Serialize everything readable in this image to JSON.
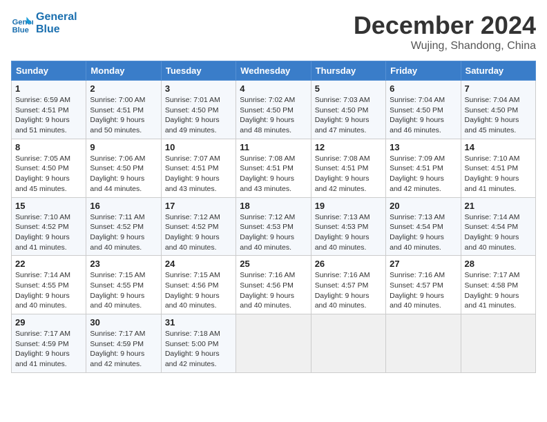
{
  "logo": {
    "line1": "General",
    "line2": "Blue"
  },
  "title": "December 2024",
  "location": "Wujing, Shandong, China",
  "days_of_week": [
    "Sunday",
    "Monday",
    "Tuesday",
    "Wednesday",
    "Thursday",
    "Friday",
    "Saturday"
  ],
  "weeks": [
    [
      {
        "day": "1",
        "sunrise": "6:59 AM",
        "sunset": "4:51 PM",
        "daylight": "9 hours and 51 minutes."
      },
      {
        "day": "2",
        "sunrise": "7:00 AM",
        "sunset": "4:51 PM",
        "daylight": "9 hours and 50 minutes."
      },
      {
        "day": "3",
        "sunrise": "7:01 AM",
        "sunset": "4:50 PM",
        "daylight": "9 hours and 49 minutes."
      },
      {
        "day": "4",
        "sunrise": "7:02 AM",
        "sunset": "4:50 PM",
        "daylight": "9 hours and 48 minutes."
      },
      {
        "day": "5",
        "sunrise": "7:03 AM",
        "sunset": "4:50 PM",
        "daylight": "9 hours and 47 minutes."
      },
      {
        "day": "6",
        "sunrise": "7:04 AM",
        "sunset": "4:50 PM",
        "daylight": "9 hours and 46 minutes."
      },
      {
        "day": "7",
        "sunrise": "7:04 AM",
        "sunset": "4:50 PM",
        "daylight": "9 hours and 45 minutes."
      }
    ],
    [
      {
        "day": "8",
        "sunrise": "7:05 AM",
        "sunset": "4:50 PM",
        "daylight": "9 hours and 45 minutes."
      },
      {
        "day": "9",
        "sunrise": "7:06 AM",
        "sunset": "4:50 PM",
        "daylight": "9 hours and 44 minutes."
      },
      {
        "day": "10",
        "sunrise": "7:07 AM",
        "sunset": "4:51 PM",
        "daylight": "9 hours and 43 minutes."
      },
      {
        "day": "11",
        "sunrise": "7:08 AM",
        "sunset": "4:51 PM",
        "daylight": "9 hours and 43 minutes."
      },
      {
        "day": "12",
        "sunrise": "7:08 AM",
        "sunset": "4:51 PM",
        "daylight": "9 hours and 42 minutes."
      },
      {
        "day": "13",
        "sunrise": "7:09 AM",
        "sunset": "4:51 PM",
        "daylight": "9 hours and 42 minutes."
      },
      {
        "day": "14",
        "sunrise": "7:10 AM",
        "sunset": "4:51 PM",
        "daylight": "9 hours and 41 minutes."
      }
    ],
    [
      {
        "day": "15",
        "sunrise": "7:10 AM",
        "sunset": "4:52 PM",
        "daylight": "9 hours and 41 minutes."
      },
      {
        "day": "16",
        "sunrise": "7:11 AM",
        "sunset": "4:52 PM",
        "daylight": "9 hours and 40 minutes."
      },
      {
        "day": "17",
        "sunrise": "7:12 AM",
        "sunset": "4:52 PM",
        "daylight": "9 hours and 40 minutes."
      },
      {
        "day": "18",
        "sunrise": "7:12 AM",
        "sunset": "4:53 PM",
        "daylight": "9 hours and 40 minutes."
      },
      {
        "day": "19",
        "sunrise": "7:13 AM",
        "sunset": "4:53 PM",
        "daylight": "9 hours and 40 minutes."
      },
      {
        "day": "20",
        "sunrise": "7:13 AM",
        "sunset": "4:54 PM",
        "daylight": "9 hours and 40 minutes."
      },
      {
        "day": "21",
        "sunrise": "7:14 AM",
        "sunset": "4:54 PM",
        "daylight": "9 hours and 40 minutes."
      }
    ],
    [
      {
        "day": "22",
        "sunrise": "7:14 AM",
        "sunset": "4:55 PM",
        "daylight": "9 hours and 40 minutes."
      },
      {
        "day": "23",
        "sunrise": "7:15 AM",
        "sunset": "4:55 PM",
        "daylight": "9 hours and 40 minutes."
      },
      {
        "day": "24",
        "sunrise": "7:15 AM",
        "sunset": "4:56 PM",
        "daylight": "9 hours and 40 minutes."
      },
      {
        "day": "25",
        "sunrise": "7:16 AM",
        "sunset": "4:56 PM",
        "daylight": "9 hours and 40 minutes."
      },
      {
        "day": "26",
        "sunrise": "7:16 AM",
        "sunset": "4:57 PM",
        "daylight": "9 hours and 40 minutes."
      },
      {
        "day": "27",
        "sunrise": "7:16 AM",
        "sunset": "4:57 PM",
        "daylight": "9 hours and 40 minutes."
      },
      {
        "day": "28",
        "sunrise": "7:17 AM",
        "sunset": "4:58 PM",
        "daylight": "9 hours and 41 minutes."
      }
    ],
    [
      {
        "day": "29",
        "sunrise": "7:17 AM",
        "sunset": "4:59 PM",
        "daylight": "9 hours and 41 minutes."
      },
      {
        "day": "30",
        "sunrise": "7:17 AM",
        "sunset": "4:59 PM",
        "daylight": "9 hours and 42 minutes."
      },
      {
        "day": "31",
        "sunrise": "7:18 AM",
        "sunset": "5:00 PM",
        "daylight": "9 hours and 42 minutes."
      },
      null,
      null,
      null,
      null
    ]
  ]
}
